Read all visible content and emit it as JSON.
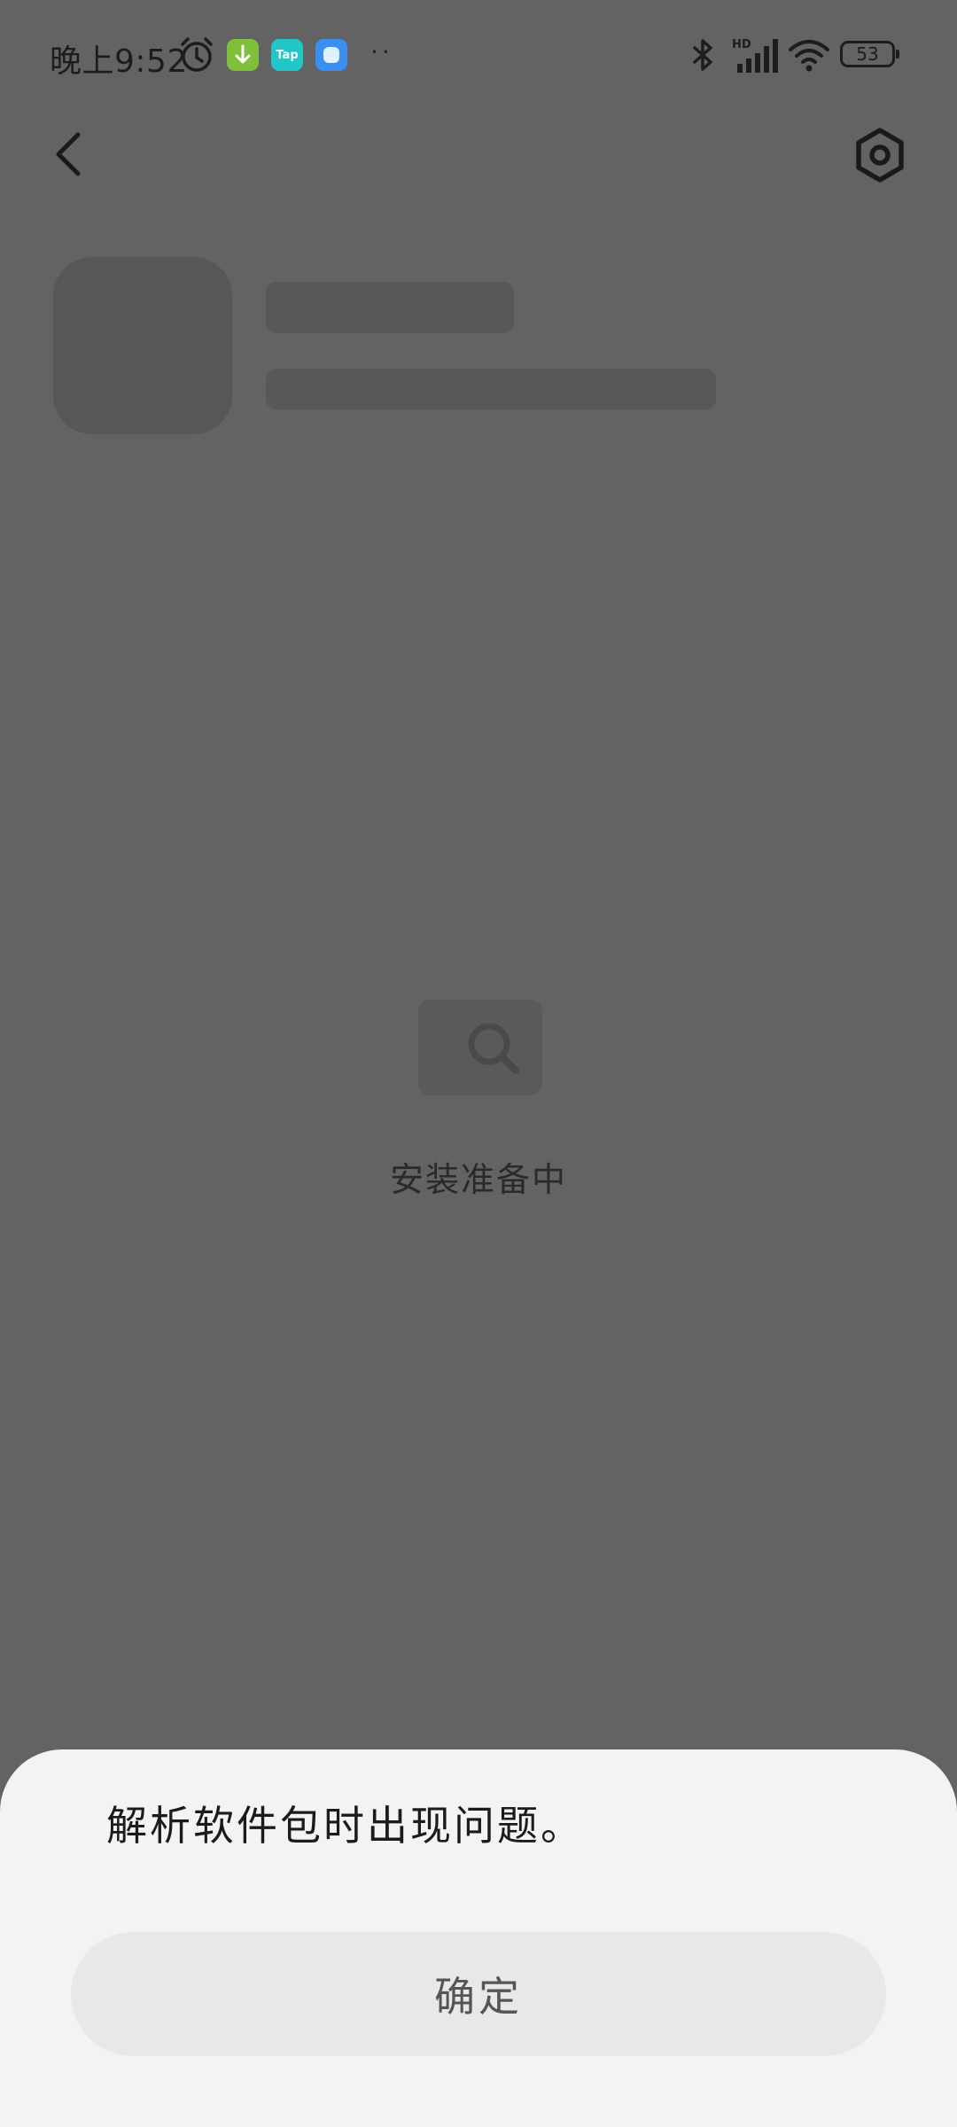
{
  "status_bar": {
    "time": "晚上9:52",
    "app_icon_2_label": "Tap",
    "overflow": "··",
    "battery": "53"
  },
  "header": {
    "back_icon": "chevron-left-icon",
    "settings_icon": "settings-hexagon-icon"
  },
  "status": {
    "icon": "search-icon",
    "text": "安装准备中"
  },
  "dialog": {
    "message": "解析软件包时出现问题。",
    "confirm_label": "确定"
  },
  "colors": {
    "overlay_background": "#636363",
    "sheet_background": "#f3f3f3",
    "button_background": "#e8e8e8"
  }
}
